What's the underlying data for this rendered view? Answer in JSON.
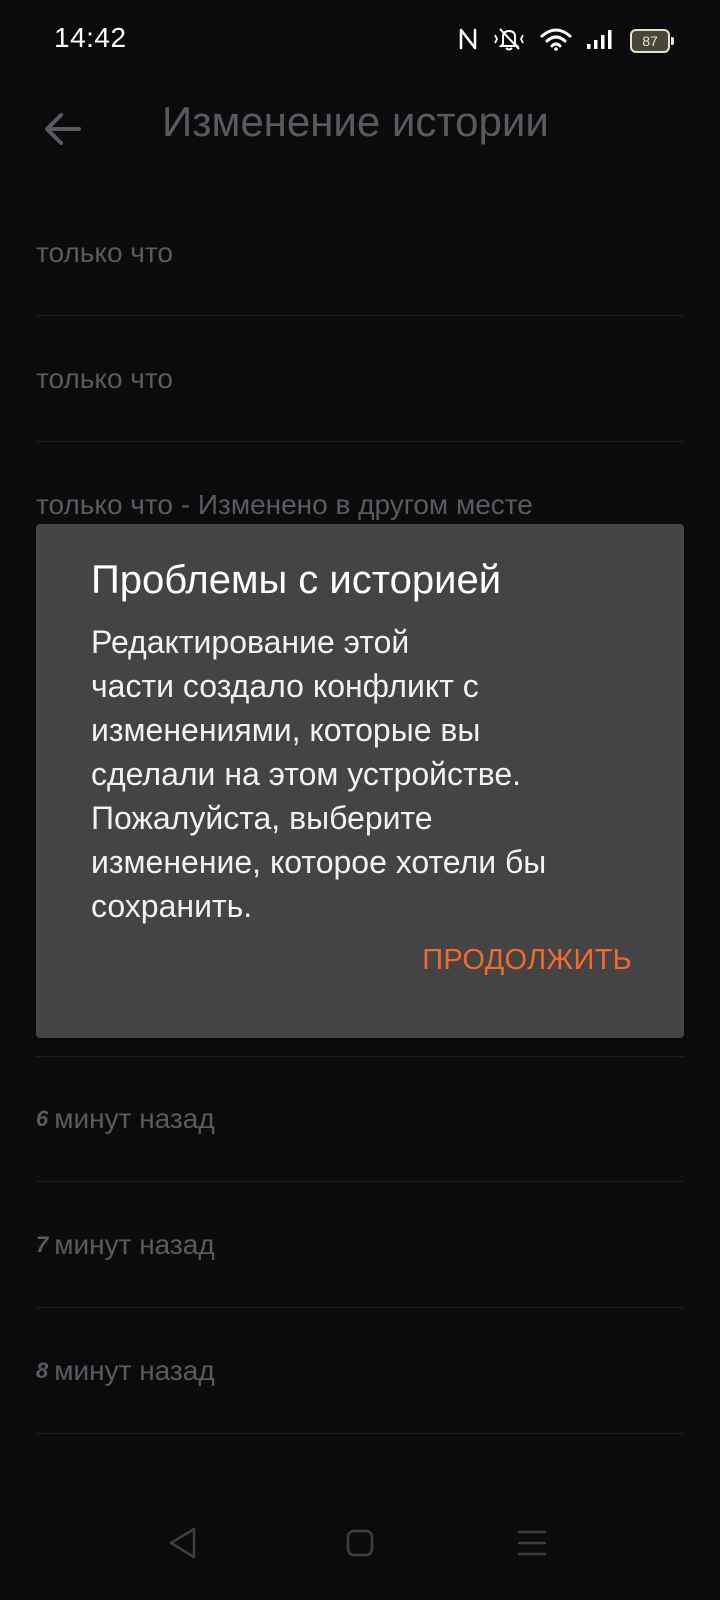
{
  "status_bar": {
    "time": "14:42",
    "battery": "87",
    "icons": [
      "nfc-icon",
      "vibrate-icon",
      "wifi-icon",
      "signal-icon",
      "battery-icon"
    ]
  },
  "app_bar": {
    "title": "Изменение истории",
    "back_icon": "arrow-left-icon"
  },
  "history": {
    "items_top": [
      {
        "label": "только что"
      },
      {
        "label": "только что"
      },
      {
        "label": "только что - Изменено в другом месте"
      }
    ],
    "items_bottom": [
      {
        "num": "6",
        "label": "минут назад"
      },
      {
        "num": "7",
        "label": "минут назад"
      },
      {
        "num": "8",
        "label": "минут назад"
      }
    ]
  },
  "dialog": {
    "title": "Проблемы с историей",
    "body_lines": [
      "Редактирование этой",
      "части создало конфликт с",
      "изменениями, которые вы",
      "сделали на этом устройстве.",
      "Пожалуйста, выберите",
      "изменение, которое хотели бы",
      "сохранить."
    ],
    "action": "ПРОДОЛЖИТЬ"
  },
  "colors": {
    "background": "#0b0a0d",
    "dialog": "#444346",
    "accent": "#f26b2b",
    "dim_text": "#5b5a5e"
  },
  "nav_bar": {
    "icons": [
      "back-triangle-icon",
      "home-square-icon",
      "recents-menu-icon"
    ]
  }
}
